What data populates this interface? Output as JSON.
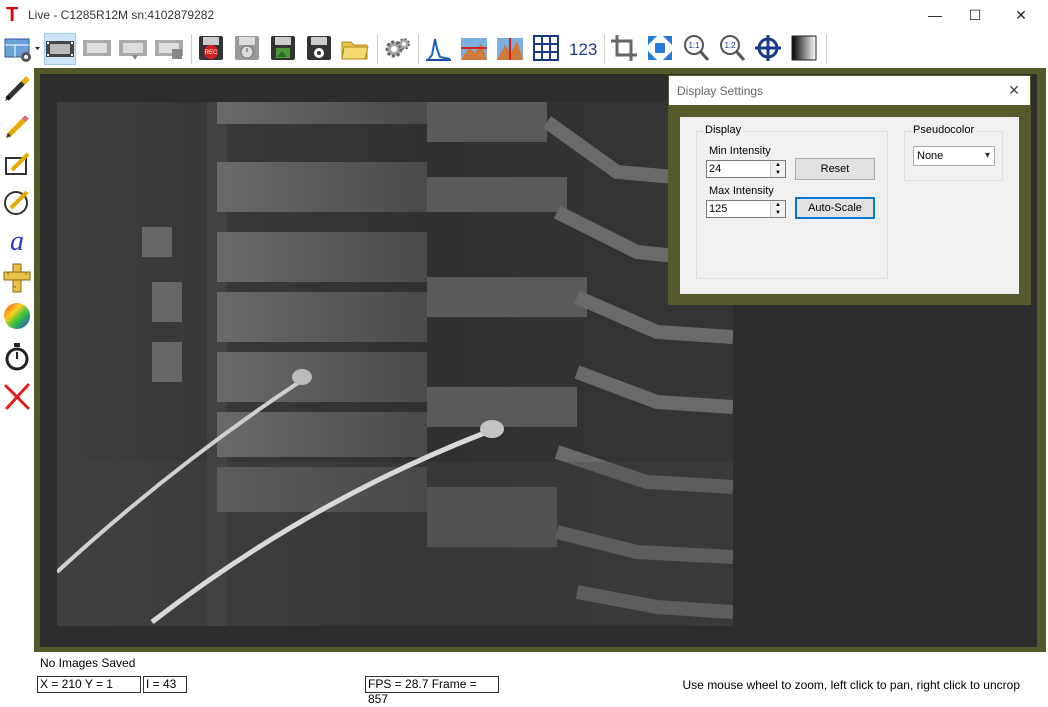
{
  "window": {
    "title": "Live - C1285R12M   sn:4102879282",
    "minimize": "—",
    "maximize": "☐",
    "close": "✕"
  },
  "toolbar": {
    "icons": [
      "layout-settings-icon",
      "filmstrip-icon",
      "filmstrip-disabled-icon",
      "filmstrip-export-icon",
      "filmstrip-save-icon",
      "record-icon",
      "timelapse-save-icon",
      "save-image-icon",
      "save-settings-icon",
      "open-folder-icon",
      "camera-settings-icon",
      "histogram-icon",
      "line-profile-icon",
      "column-profile-icon",
      "grid-icon",
      "numbering-icon",
      "crop-icon",
      "fit-to-window-icon",
      "zoom-1-1-icon",
      "zoom-1-2-icon",
      "crosshair-icon",
      "display-range-icon"
    ],
    "record_label": "REC",
    "zoom_1_1_label": "1:1",
    "zoom_1_2_label": "1:2",
    "numbering_label": "123"
  },
  "left_tools": [
    "pen-marker-icon",
    "pencil-icon",
    "rectangle-draw-icon",
    "ellipse-draw-icon",
    "text-tool-icon",
    "ruler-icon",
    "color-wheel-icon",
    "stopwatch-icon",
    "clear-annotations-icon"
  ],
  "text_tool_glyph": "a",
  "display_settings": {
    "title": "Display Settings",
    "close": "✕",
    "display_group": "Display",
    "min_label": "Min Intensity",
    "min_value": "24",
    "max_label": "Max Intensity",
    "max_value": "125",
    "reset_label": "Reset",
    "autoscale_label": "Auto-Scale",
    "pseudocolor_group": "Pseudocolor",
    "pseudocolor_value": "None"
  },
  "status": {
    "saved": "No Images Saved",
    "coords": "X = 210  Y = 1",
    "intensity": "I = 43",
    "fps": "FPS = 28.7  Frame = 857",
    "hint": "Use mouse wheel to zoom, left click to pan, right click to uncrop"
  },
  "colors": {
    "accent": "#0078d7",
    "viewport_border": "#565a2a",
    "record_red": "#e00000"
  }
}
